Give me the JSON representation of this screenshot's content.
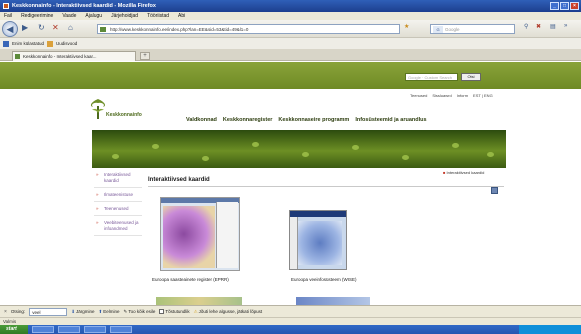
{
  "window": {
    "title": "Keskkonnainfo - Interaktiivsed kaardid - Mozilla Firefox"
  },
  "menu": [
    "Fail",
    "Redigeerimine",
    "Vaade",
    "Ajalugu",
    "Järjehoidjad",
    "Tööriistad",
    "Abi"
  ],
  "navigation": {
    "url": "http://www.keskkonnainfo.ee/index.php?lan=EE&sid=53&tid=49&l1=0",
    "search_engine": "Google",
    "search_placeholder": "Google"
  },
  "bookmarks": [
    "Enim külastatud",
    "Uudisvood"
  ],
  "tabs": [
    {
      "label": "Keskkonnainfo - Interaktiivsed kaar..."
    }
  ],
  "site": {
    "search_placeholder": "Google · Custom Search",
    "search_button": "Otsi",
    "top_links": [
      "Teenused",
      "Sissluawrd",
      "Inform",
      "EST | ENG"
    ],
    "logo_text": "Keskkonnainfo",
    "main_nav": [
      "Valdkonnad",
      "Keskkonnaregister",
      "Keskkonnaseire programm",
      "Infosüsteemid ja aruandlus"
    ],
    "breadcrumb": "Interaktiivsed kaardid",
    "sidebar": [
      {
        "label": "Interaktiivsed kaardid",
        "active": true
      },
      {
        "label": "Ilmateenistuse"
      },
      {
        "label": "Teenenused"
      },
      {
        "label": "Veebiteenused ja infoandmed"
      }
    ],
    "content_title": "Interaktiivsed kaardid",
    "maps": [
      {
        "caption": "Euroopa saasteainete register (EPRR)"
      },
      {
        "caption": "Euroopa veeinfosüsteem (WISE)"
      }
    ]
  },
  "findbar": {
    "label": "Otsing:",
    "value": "veel",
    "next": "Järgmine",
    "previous": "Eelmine",
    "highlight": "Too kõik esile",
    "match_case": "Tõstutundlik",
    "message": "Jõuti lehe algusse, jätkati lõpust"
  },
  "status": "Valmis"
}
